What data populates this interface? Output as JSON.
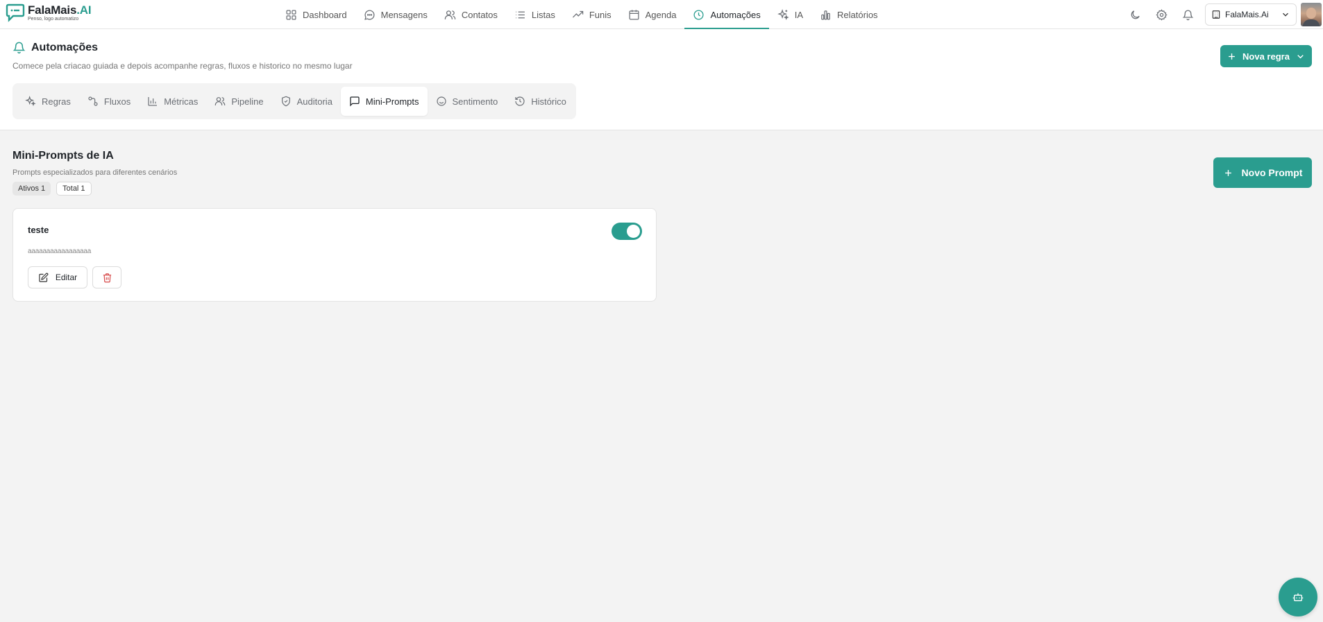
{
  "brand": {
    "name": "FalaMais",
    "name_suffix": ".AI",
    "tagline": "Penso, logo automatizo",
    "color": "#2a9d8f"
  },
  "nav": {
    "items": [
      {
        "label": "Dashboard",
        "icon": "grid-icon"
      },
      {
        "label": "Mensagens",
        "icon": "message-circle-icon"
      },
      {
        "label": "Contatos",
        "icon": "users-icon"
      },
      {
        "label": "Listas",
        "icon": "list-icon"
      },
      {
        "label": "Funis",
        "icon": "trending-up-icon"
      },
      {
        "label": "Agenda",
        "icon": "calendar-icon"
      },
      {
        "label": "Automações",
        "icon": "clock-icon",
        "active": true
      },
      {
        "label": "IA",
        "icon": "sparkles-icon"
      },
      {
        "label": "Relatórios",
        "icon": "bar-chart-icon"
      }
    ]
  },
  "topbar": {
    "icons": [
      "moon-icon",
      "gear-icon",
      "bell-icon"
    ],
    "account_label": "FalaMais.Ai"
  },
  "header": {
    "title": "Automações",
    "subtitle": "Comece pela criacao guiada e depois acompanhe regras, fluxos e historico no mesmo lugar",
    "new_rule_label": "Nova regra"
  },
  "tabs": [
    {
      "label": "Regras",
      "icon": "sparkles-icon"
    },
    {
      "label": "Fluxos",
      "icon": "workflow-icon"
    },
    {
      "label": "Métricas",
      "icon": "bar-chart-icon"
    },
    {
      "label": "Pipeline",
      "icon": "users-icon"
    },
    {
      "label": "Auditoria",
      "icon": "shield-check-icon"
    },
    {
      "label": "Mini-Prompts",
      "icon": "message-square-icon",
      "active": true
    },
    {
      "label": "Sentimento",
      "icon": "smile-icon"
    },
    {
      "label": "Histórico",
      "icon": "history-icon"
    }
  ],
  "content": {
    "title": "Mini-Prompts de IA",
    "subtitle": "Prompts especializados para diferentes cenários",
    "badge_active": "Ativos 1",
    "badge_total": "Total 1",
    "new_prompt_label": "Novo Prompt"
  },
  "prompts": [
    {
      "name": "teste",
      "text": "aaaaaaaaaaaaaaaaa",
      "enabled": true,
      "edit_label": "Editar"
    }
  ]
}
